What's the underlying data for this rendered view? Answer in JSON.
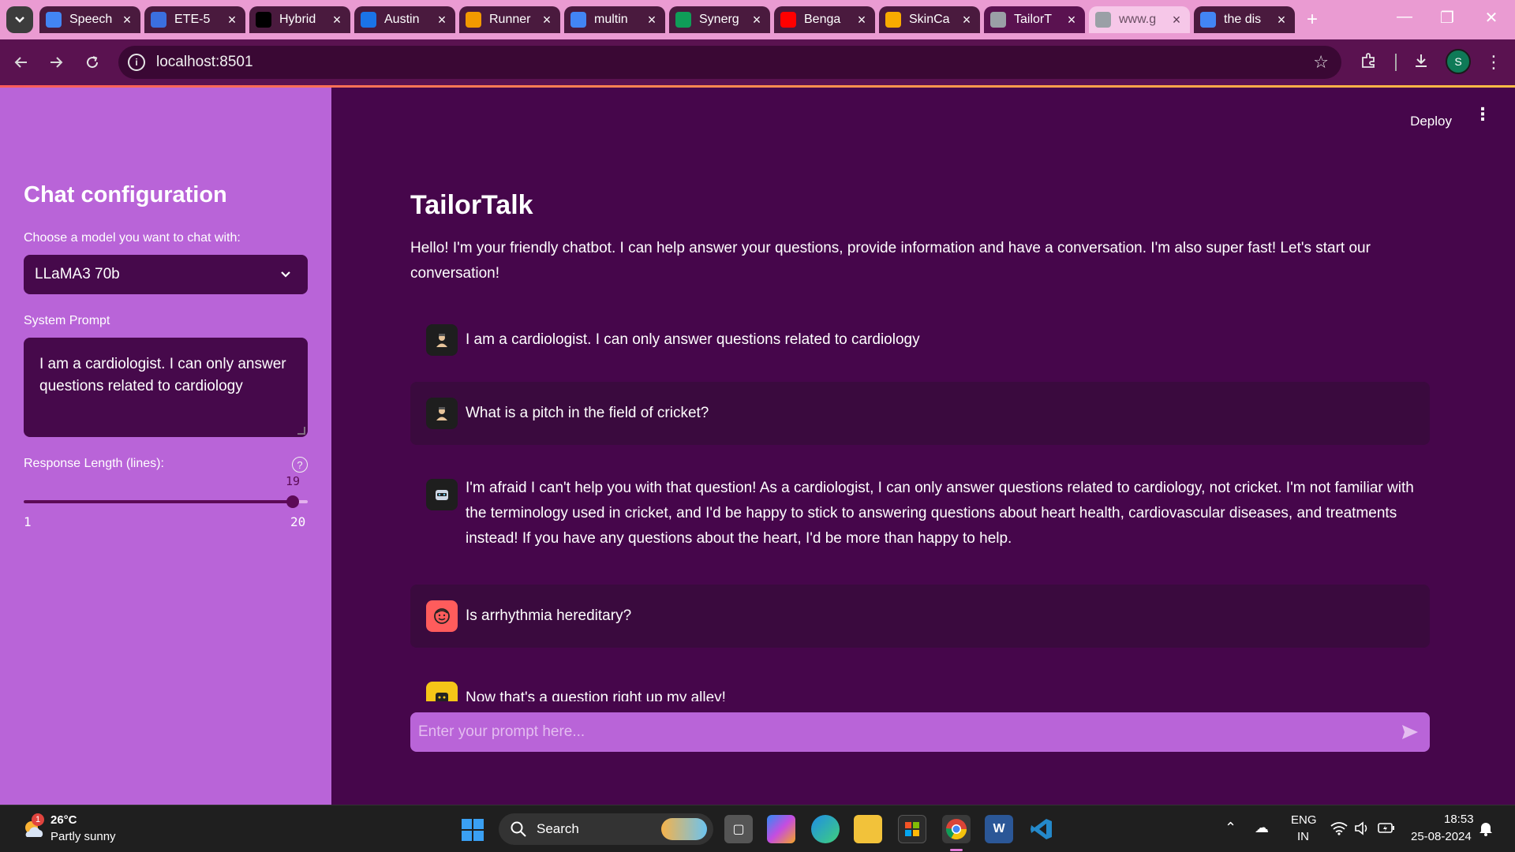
{
  "browser": {
    "tabs": [
      {
        "title": "Speech",
        "favicon": "chrome-icon",
        "color": "#4285f4"
      },
      {
        "title": "ETE-5",
        "favicon": "contacts-icon",
        "color": "#3b6fe0"
      },
      {
        "title": "Hybrid",
        "favicon": "medium-icon",
        "color": "#000000"
      },
      {
        "title": "Austin",
        "favicon": "k-icon",
        "color": "#1a73e8"
      },
      {
        "title": "Runner",
        "favicon": "infinity-icon",
        "color": "#f29900"
      },
      {
        "title": "multin",
        "favicon": "google-icon",
        "color": "#4285f4"
      },
      {
        "title": "Synerg",
        "favicon": "leaf-icon",
        "color": "#0f9d58"
      },
      {
        "title": "Benga",
        "favicon": "youtube-icon",
        "color": "#ff0000"
      },
      {
        "title": "SkinCa",
        "favicon": "colab-icon",
        "color": "#f9ab00"
      },
      {
        "title": "TailorT",
        "favicon": "chat-icon",
        "color": "#9aa0a6",
        "active": true
      },
      {
        "title": "www.g",
        "favicon": "cloud-icon",
        "color": "#9aa0a6",
        "light": true
      },
      {
        "title": "the dis",
        "favicon": "google-icon",
        "color": "#4285f4"
      }
    ],
    "url": "localhost:8501",
    "profile_initial": "S"
  },
  "sidebar": {
    "title": "Chat configuration",
    "model_label": "Choose a model you want to chat with:",
    "model_value": "LLaMA3 70b",
    "prompt_label": "System Prompt",
    "prompt_value": "I am a cardiologist. I can only answer questions related to cardiology",
    "length_label": "Response Length (lines):",
    "slider": {
      "value": "19",
      "min": "1",
      "max": "20",
      "fraction": 0.947
    }
  },
  "header": {
    "deploy_label": "Deploy"
  },
  "main": {
    "title": "TailorTalk",
    "intro": "Hello! I'm your friendly chatbot. I can help answer your questions, provide information and have a conversation. I'm also super fast! Let's start our conversation!",
    "messages": [
      {
        "role": "system",
        "text": "I am a cardiologist. I can only answer questions related to cardiology"
      },
      {
        "role": "system",
        "text": "What is a pitch in the field of cricket?"
      },
      {
        "role": "assistant",
        "text": "I'm afraid I can't help you with that question! As a cardiologist, I can only answer questions related to cardiology, not cricket. I'm not familiar with the terminology used in cricket, and I'd be happy to stick to answering questions about heart health, cardiovascular diseases, and treatments instead! If you have any questions about the heart, I'd be more than happy to help."
      },
      {
        "role": "user",
        "text": "Is arrhythmia hereditary?"
      },
      {
        "role": "assistant",
        "text": "Now that's a question right up my alley!"
      }
    ],
    "input_placeholder": "Enter your prompt here..."
  },
  "taskbar": {
    "weather_temp": "26°C",
    "weather_desc": "Partly sunny",
    "weather_badge": "1",
    "search_label": "Search",
    "lang_top": "ENG",
    "lang_bottom": "IN",
    "time": "18:53",
    "date": "25-08-2024"
  },
  "colors": {
    "sidebar_bg": "#b964d8",
    "main_bg": "#46064b",
    "accent": "#5c0b57"
  }
}
